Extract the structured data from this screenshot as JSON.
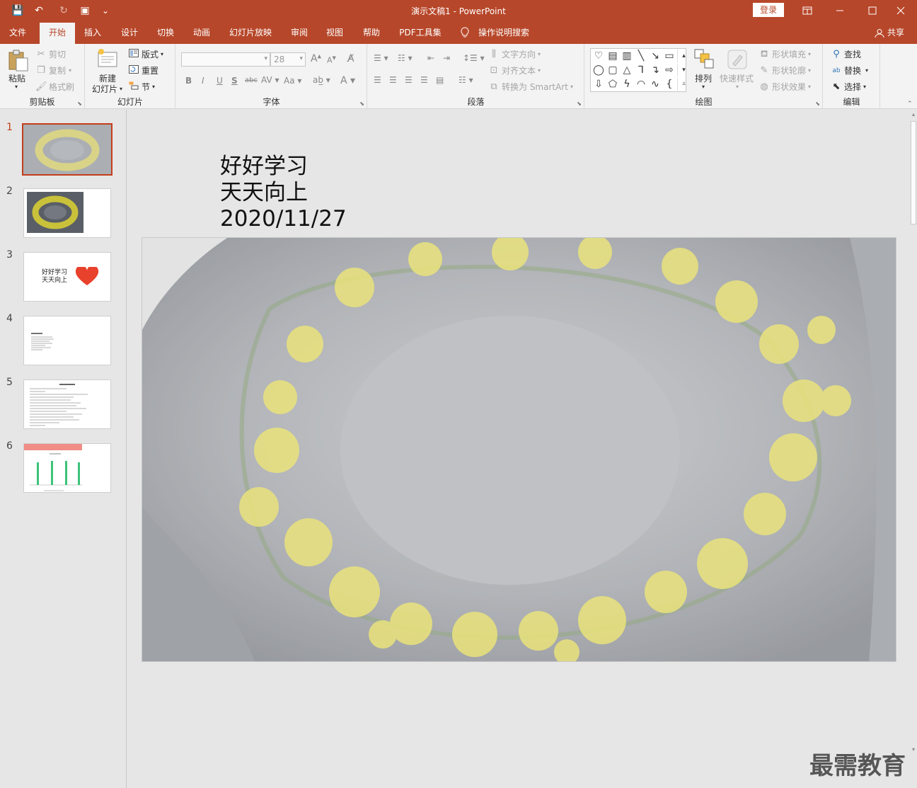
{
  "titlebar": {
    "title": "演示文稿1  -  PowerPoint",
    "login": "登录",
    "qa_save": "💾",
    "qa_undo": "↶",
    "qa_redo": "↻",
    "qa_present": "▣",
    "qa_more": "⌄"
  },
  "menu": {
    "tabs": [
      {
        "label": "文件"
      },
      {
        "label": "开始"
      },
      {
        "label": "插入"
      },
      {
        "label": "设计"
      },
      {
        "label": "切换"
      },
      {
        "label": "动画"
      },
      {
        "label": "幻灯片放映"
      },
      {
        "label": "审阅"
      },
      {
        "label": "视图"
      },
      {
        "label": "帮助"
      },
      {
        "label": "PDF工具集"
      },
      {
        "label": "操作说明搜索"
      }
    ],
    "share": "共享"
  },
  "ribbon": {
    "clipboard": {
      "label": "剪贴板",
      "paste": "粘贴",
      "cut": "剪切",
      "copy": "复制",
      "format_painter": "格式刷"
    },
    "slides": {
      "label": "幻灯片",
      "new_slide_1": "新建",
      "new_slide_2": "幻灯片",
      "layout": "版式",
      "reset": "重置",
      "section": "节"
    },
    "font": {
      "label": "字体",
      "font_size": "28"
    },
    "paragraph": {
      "label": "段落",
      "text_direction": "文字方向",
      "align_text": "对齐文本",
      "smartart": "转换为 SmartArt"
    },
    "drawing": {
      "label": "绘图",
      "arrange": "排列",
      "quick_styles": "快速样式",
      "shape_fill": "形状填充",
      "shape_outline": "形状轮廓",
      "shape_effects": "形状效果"
    },
    "editing": {
      "label": "编辑",
      "find": "查找",
      "replace": "替换",
      "select": "选择"
    }
  },
  "thumbnails": [
    {
      "num": "1"
    },
    {
      "num": "2"
    },
    {
      "num": "3",
      "text_1": "好好学习",
      "text_2": "天天向上"
    },
    {
      "num": "4"
    },
    {
      "num": "5"
    },
    {
      "num": "6"
    }
  ],
  "slide": {
    "line1": "好好学习",
    "line2": "天天向上",
    "line3": "2020/11/27"
  },
  "watermark": "最需教育"
}
